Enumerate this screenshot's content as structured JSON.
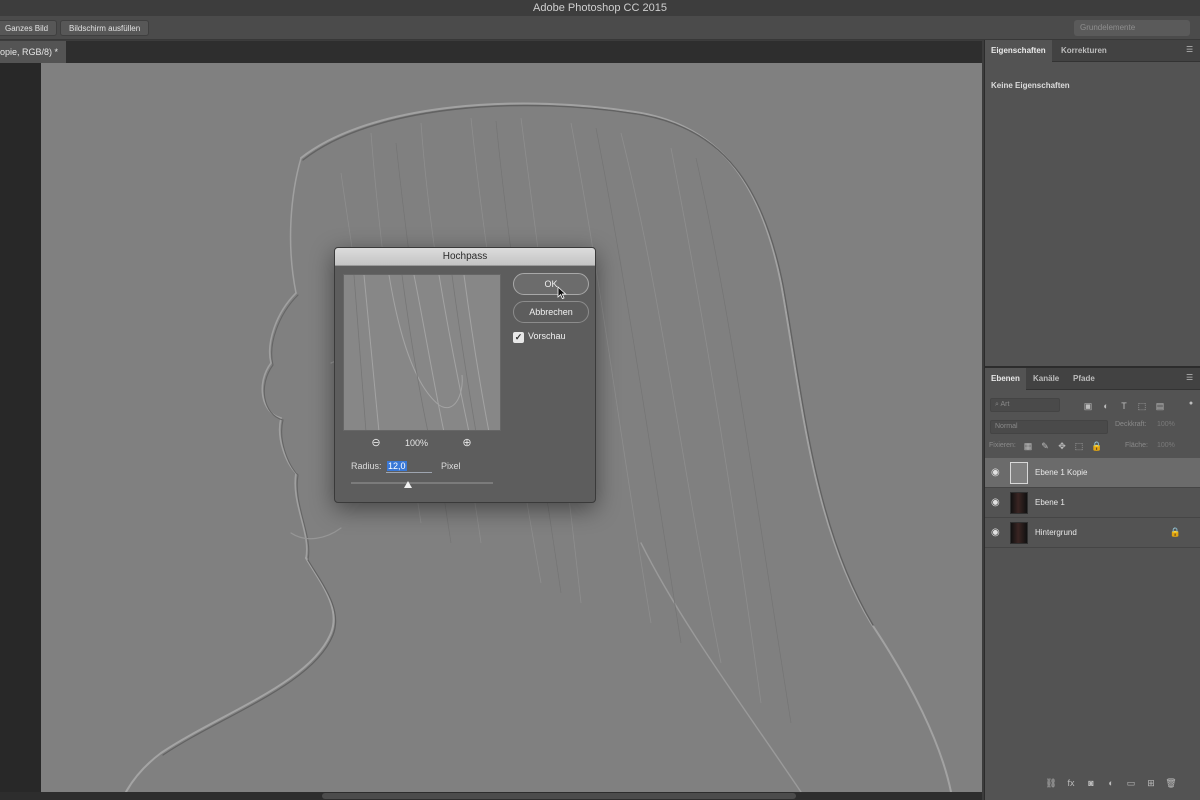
{
  "app": {
    "title": "Adobe Photoshop CC 2015"
  },
  "options_bar": {
    "fit_screen": "Ganzes Bild",
    "fill_screen": "Bildschirm ausfüllen",
    "workspace": "Grundelemente"
  },
  "document": {
    "tab_label": "opie, RGB/8) *"
  },
  "properties_panel": {
    "tabs": [
      "Eigenschaften",
      "Korrekturen"
    ],
    "empty_text": "Keine Eigenschaften"
  },
  "layers_panel": {
    "tabs": [
      "Ebenen",
      "Kanäle",
      "Pfade"
    ],
    "filter_placeholder": "Art",
    "blend_mode": "Normal",
    "opacity_label": "Deckkraft:",
    "opacity_value": "100%",
    "fill_label": "Fläche:",
    "fill_value": "100%",
    "lock_label": "Fixieren:",
    "layers": [
      {
        "name": "Ebene 1 Kopie",
        "visible": true,
        "selected": true,
        "locked": false
      },
      {
        "name": "Ebene 1",
        "visible": true,
        "selected": false,
        "locked": false
      },
      {
        "name": "Hintergrund",
        "visible": true,
        "selected": false,
        "locked": true
      }
    ]
  },
  "dialog": {
    "title": "Hochpass",
    "ok_label": "OK",
    "cancel_label": "Abbrechen",
    "preview_label": "Vorschau",
    "preview_checked": true,
    "zoom_value": "100%",
    "radius_label": "Radius:",
    "radius_value": "12,0",
    "radius_unit": "Pixel"
  },
  "colors": {
    "canvas_gray": "#808080",
    "panel": "#535353",
    "selection": "#3a78d6"
  }
}
